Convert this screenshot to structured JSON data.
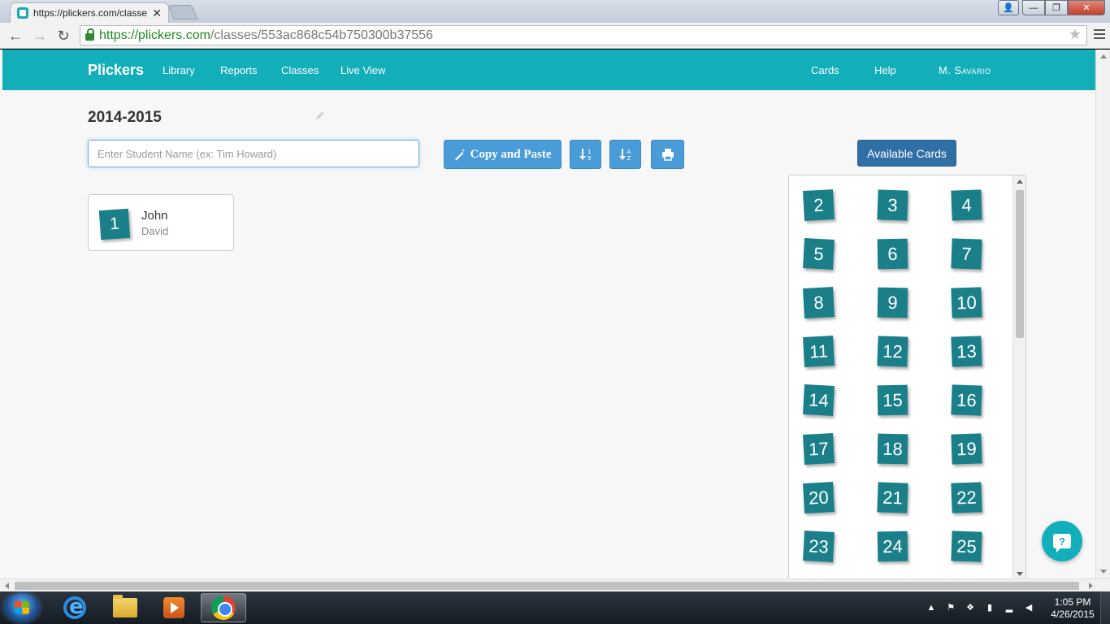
{
  "browser": {
    "tab_title": "https://plickers.com/classe",
    "url_scheme": "https://",
    "url_host": "plickers.com",
    "url_path": "/classes/553ac868c54b750300b37556"
  },
  "nav": {
    "brand": "Plickers",
    "links": [
      "Library",
      "Reports",
      "Classes",
      "Live View"
    ],
    "right_links": [
      "Cards",
      "Help"
    ],
    "user": "M. Savario"
  },
  "page": {
    "class_title": "2014-2015",
    "student_input_placeholder": "Enter Student Name (ex: Tim Howard)",
    "copy_paste_label": "Copy and Paste",
    "available_cards_label": "Available Cards"
  },
  "students": [
    {
      "card": "1",
      "first": "John",
      "last": "David"
    }
  ],
  "available_cards": [
    "2",
    "3",
    "4",
    "5",
    "6",
    "7",
    "8",
    "9",
    "10",
    "11",
    "12",
    "13",
    "14",
    "15",
    "16",
    "17",
    "18",
    "19",
    "20",
    "21",
    "22",
    "23",
    "24",
    "25"
  ],
  "help_bubble": "?",
  "taskbar": {
    "time": "1:05 PM",
    "date": "4/26/2015"
  },
  "colors": {
    "navbar": "#12aeb9",
    "card": "#1b7f8a",
    "button": "#4a9cd8",
    "button_dark": "#2f6fa6"
  }
}
